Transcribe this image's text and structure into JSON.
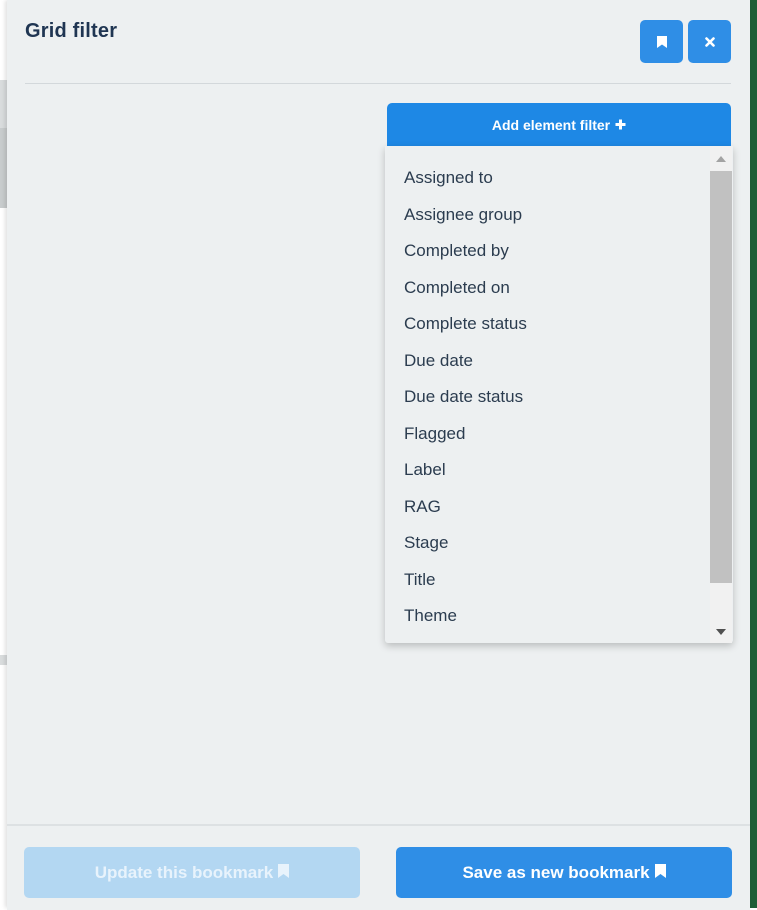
{
  "panel": {
    "title": "Grid filter",
    "icons": {
      "bookmark": "bookmark-icon",
      "close": "close-icon"
    }
  },
  "add_filter": {
    "label": "Add element filter",
    "icon": "plus-icon"
  },
  "dropdown": {
    "items": [
      "Assigned to",
      "Assignee group",
      "Completed by",
      "Completed on",
      "Complete status",
      "Due date",
      "Due date status",
      "Flagged",
      "Label",
      "RAG",
      "Stage",
      "Title",
      "Theme"
    ]
  },
  "footer": {
    "update_label": "Update this bookmark",
    "save_label": "Save as new bookmark"
  },
  "colors": {
    "accent": "#2f8ee6",
    "accent_dark": "#1e88e5",
    "accent_disabled": "#b3d7f2",
    "title": "#1f3552",
    "panel_bg": "#edf0f1"
  }
}
